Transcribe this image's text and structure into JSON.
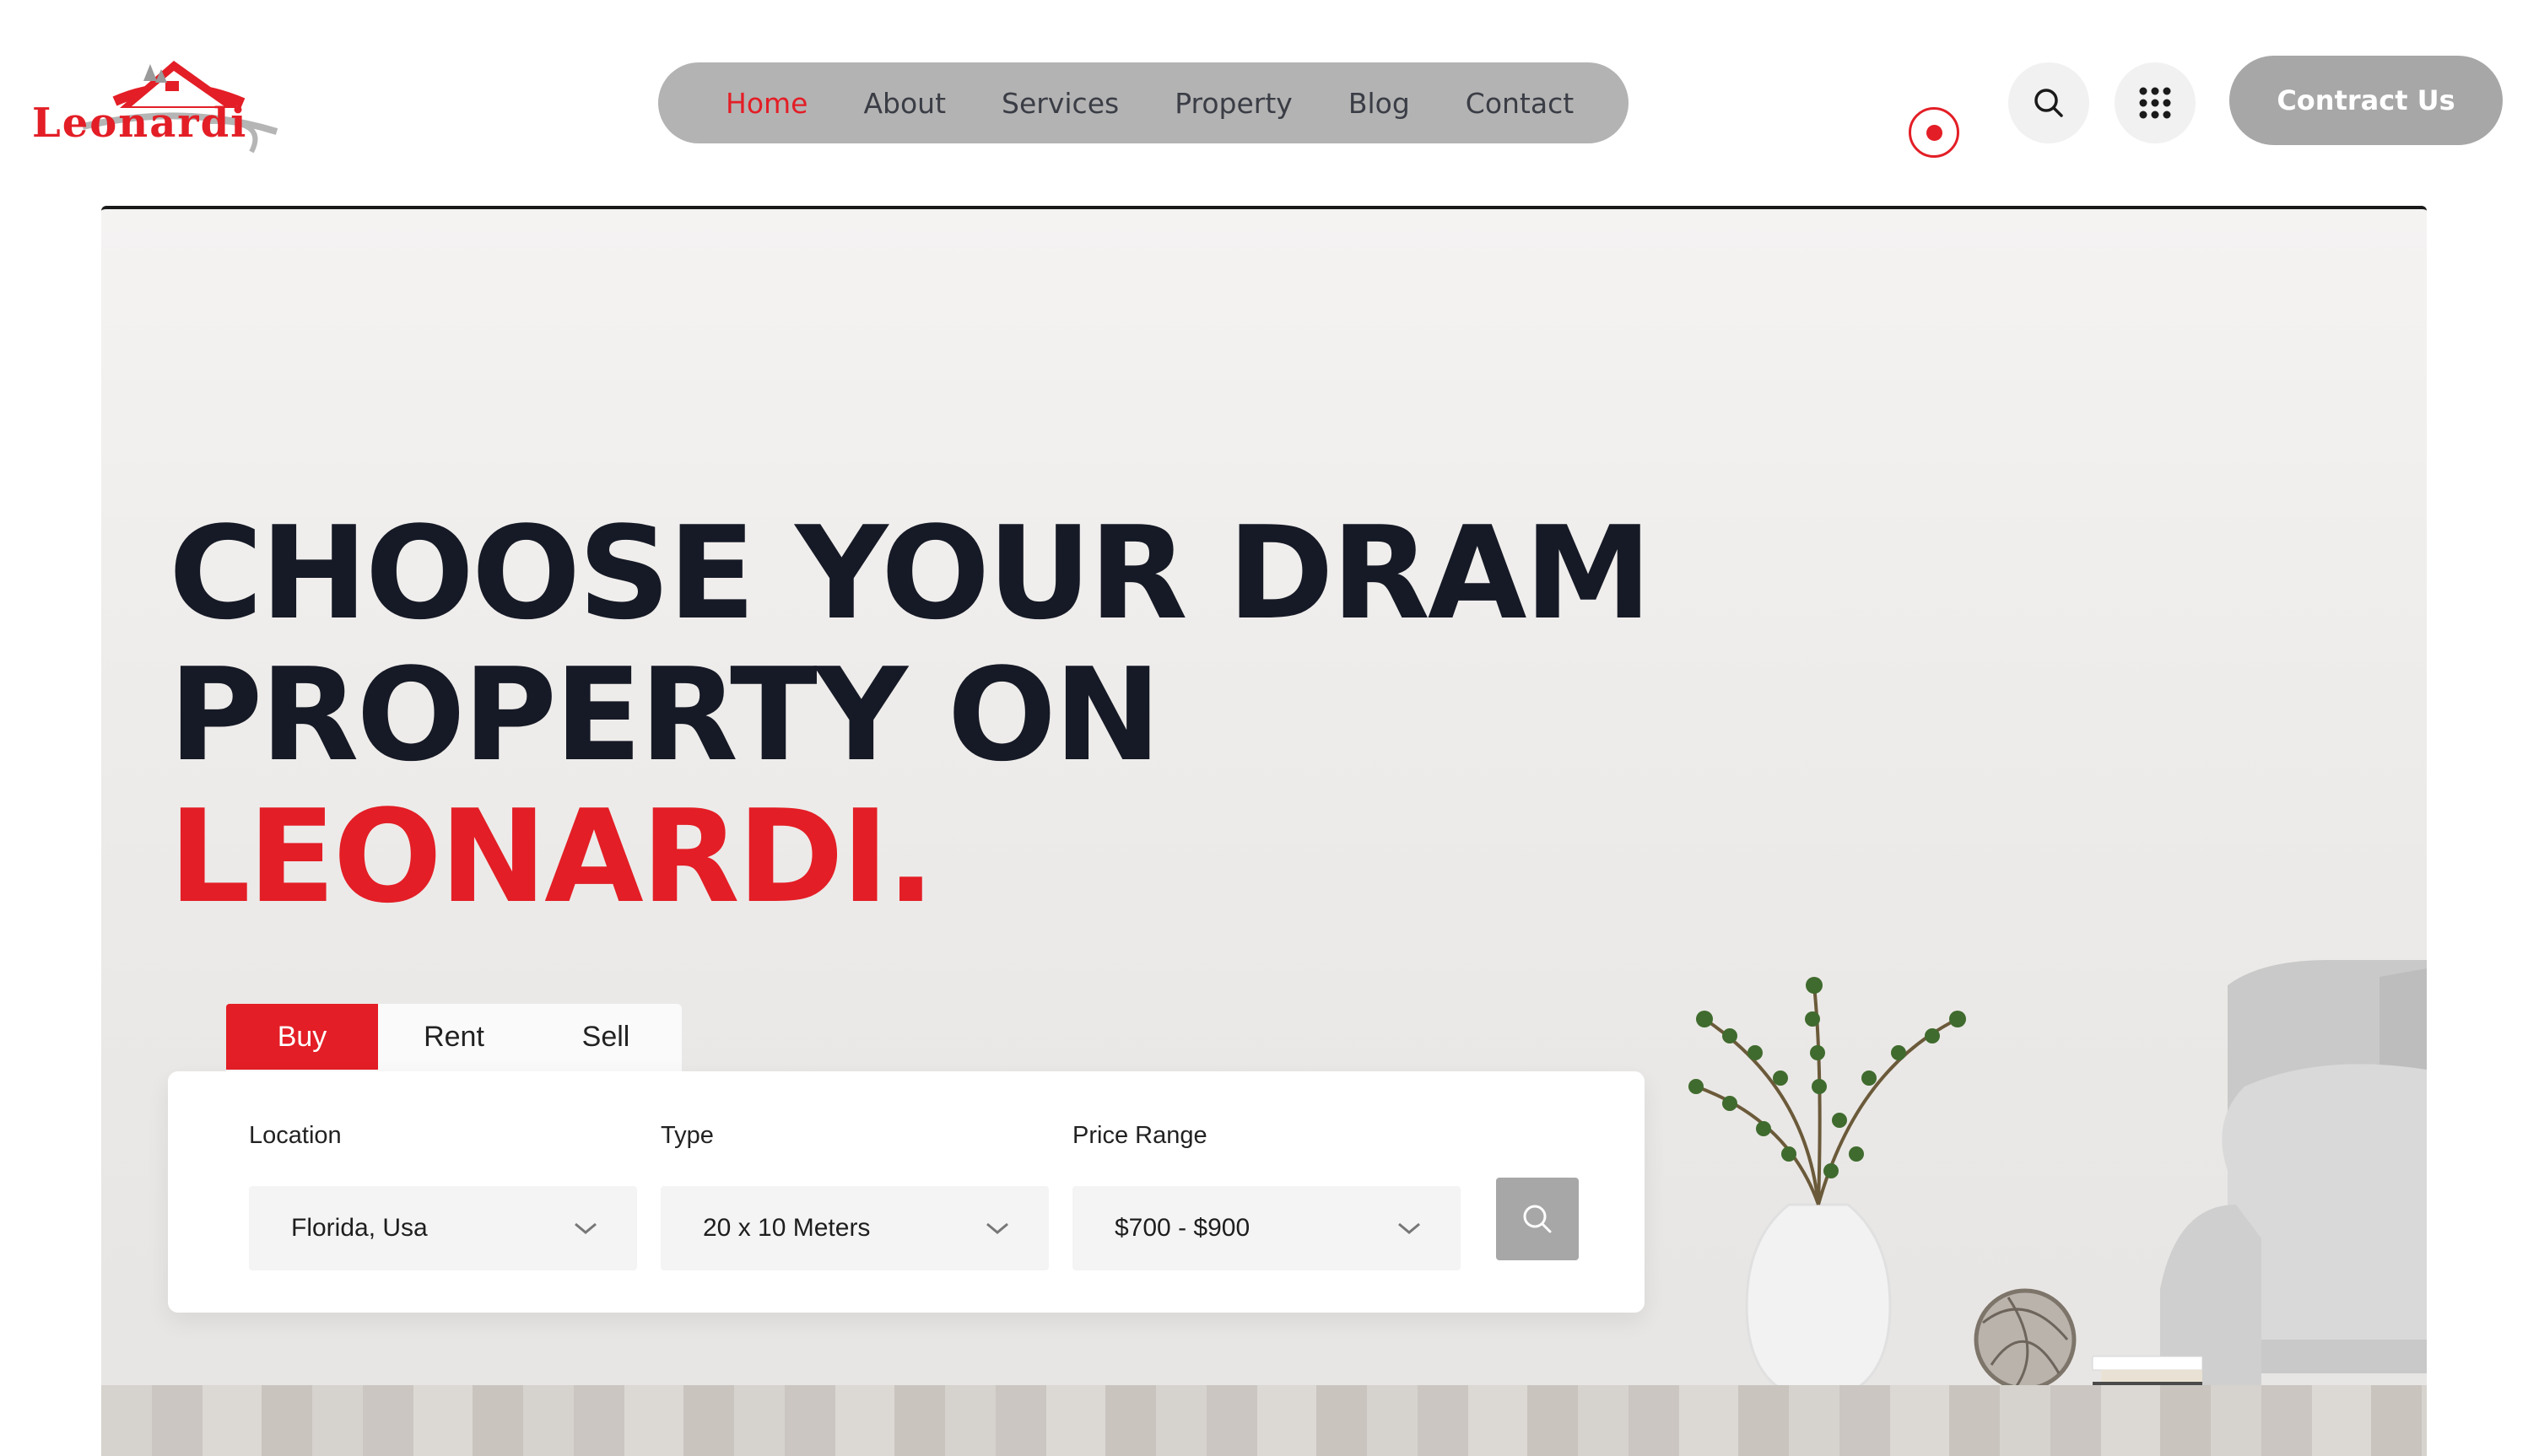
{
  "brand": {
    "name": "Leonardi",
    "accent": "#e31e26"
  },
  "nav": {
    "items": [
      {
        "label": "Home",
        "active": true
      },
      {
        "label": "About",
        "active": false
      },
      {
        "label": "Services",
        "active": false
      },
      {
        "label": "Property",
        "active": false
      },
      {
        "label": "Blog",
        "active": false
      },
      {
        "label": "Contact",
        "active": false
      }
    ]
  },
  "header": {
    "search_icon": "search-icon",
    "menu_icon": "grid-dots-icon",
    "contact_label": "Contract Us"
  },
  "hero": {
    "line1": "CHOOSE YOUR DRAM",
    "line2": "PROPERTY ON",
    "line3": "LEONARDI."
  },
  "search": {
    "tabs": [
      {
        "label": "Buy",
        "active": true
      },
      {
        "label": "Rent",
        "active": false
      },
      {
        "label": "Sell",
        "active": false
      }
    ],
    "fields": [
      {
        "label": "Location",
        "value": "Florida, Usa"
      },
      {
        "label": "Type",
        "value": "20 x 10 Meters"
      },
      {
        "label": "Price Range",
        "value": "$700 - $900"
      }
    ],
    "submit_icon": "search-icon"
  }
}
